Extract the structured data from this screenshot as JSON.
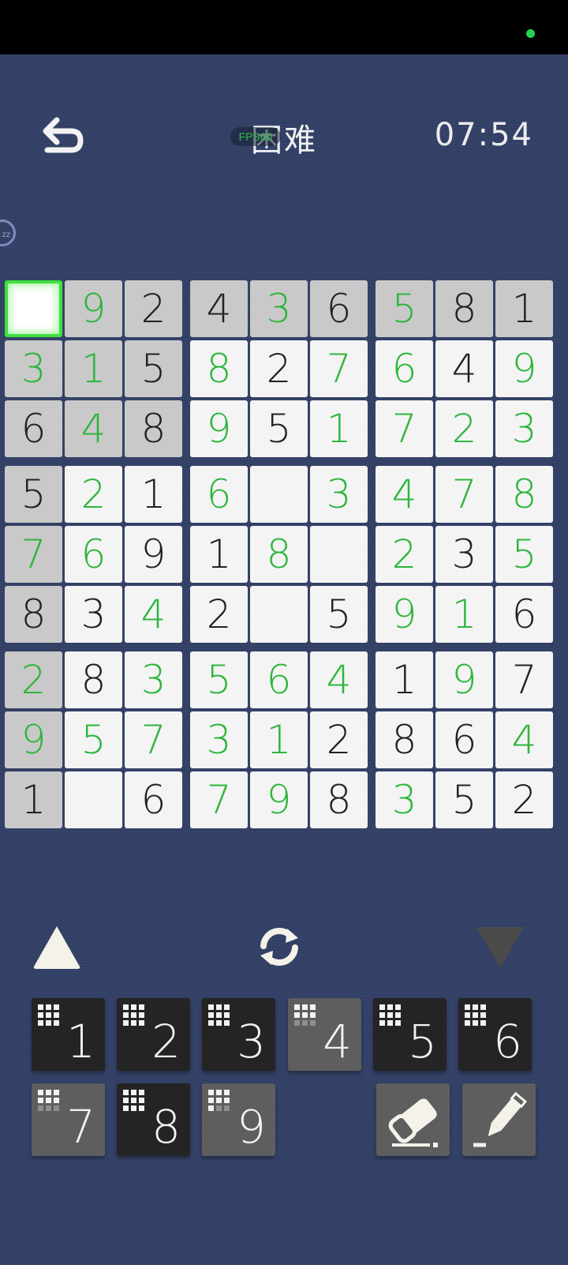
{
  "header": {
    "title": "困难",
    "fps_badge": "FPS60",
    "timer": "07:54",
    "side_badge": "zz"
  },
  "colors": {
    "background": "#334066",
    "given_cell": "#c9c9c9",
    "filled_cell": "#f4f4f4",
    "green_digit": "#2db63a",
    "dark_digit": "#222222",
    "selection": "#3fe03f"
  },
  "board": {
    "rows": [
      [
        "",
        "9",
        "2",
        "4",
        "3",
        "6",
        "5",
        "8",
        "1"
      ],
      [
        "3",
        "1",
        "5",
        "8",
        "2",
        "7",
        "6",
        "4",
        "9"
      ],
      [
        "6",
        "4",
        "8",
        "9",
        "5",
        "1",
        "7",
        "2",
        "3"
      ],
      [
        "5",
        "2",
        "1",
        "6",
        "",
        "3",
        "4",
        "7",
        "8"
      ],
      [
        "7",
        "6",
        "9",
        "1",
        "8",
        "",
        "2",
        "3",
        "5"
      ],
      [
        "8",
        "3",
        "4",
        "2",
        "",
        "5",
        "9",
        "1",
        "6"
      ],
      [
        "2",
        "8",
        "3",
        "5",
        "6",
        "4",
        "1",
        "9",
        "7"
      ],
      [
        "9",
        "5",
        "7",
        "3",
        "1",
        "2",
        "8",
        "6",
        "4"
      ],
      [
        "1",
        "",
        "6",
        "7",
        "9",
        "8",
        "3",
        "5",
        "2"
      ]
    ],
    "given": [
      [
        1,
        1,
        1,
        1,
        1,
        1,
        1,
        1,
        1
      ],
      [
        1,
        1,
        1,
        0,
        0,
        0,
        0,
        0,
        0
      ],
      [
        1,
        1,
        1,
        0,
        0,
        0,
        0,
        0,
        0
      ],
      [
        1,
        0,
        0,
        0,
        0,
        0,
        0,
        0,
        0
      ],
      [
        1,
        0,
        0,
        0,
        0,
        0,
        0,
        0,
        0
      ],
      [
        1,
        0,
        0,
        0,
        0,
        0,
        0,
        0,
        0
      ],
      [
        1,
        0,
        0,
        0,
        0,
        0,
        0,
        0,
        0
      ],
      [
        1,
        0,
        0,
        0,
        0,
        0,
        0,
        0,
        0
      ],
      [
        1,
        0,
        0,
        0,
        0,
        0,
        0,
        0,
        0
      ]
    ],
    "green": [
      [
        0,
        1,
        0,
        0,
        1,
        0,
        1,
        0,
        0
      ],
      [
        1,
        1,
        0,
        1,
        0,
        1,
        1,
        0,
        1
      ],
      [
        0,
        1,
        0,
        1,
        0,
        1,
        1,
        1,
        1
      ],
      [
        0,
        1,
        0,
        1,
        0,
        1,
        1,
        1,
        1
      ],
      [
        1,
        1,
        0,
        0,
        1,
        0,
        1,
        0,
        1
      ],
      [
        0,
        0,
        1,
        0,
        0,
        0,
        1,
        1,
        0
      ],
      [
        1,
        0,
        1,
        1,
        1,
        1,
        0,
        1,
        0
      ],
      [
        1,
        1,
        1,
        1,
        1,
        0,
        0,
        0,
        1
      ],
      [
        0,
        0,
        0,
        1,
        1,
        0,
        1,
        0,
        0
      ]
    ],
    "selected": [
      0,
      0
    ]
  },
  "keypad": {
    "keys": [
      {
        "label": "1",
        "used": false,
        "dots": 9
      },
      {
        "label": "2",
        "used": false,
        "dots": 9
      },
      {
        "label": "3",
        "used": false,
        "dots": 9
      },
      {
        "label": "4",
        "used": true,
        "dots": 6
      },
      {
        "label": "5",
        "used": false,
        "dots": 9
      },
      {
        "label": "6",
        "used": false,
        "dots": 9
      },
      {
        "label": "7",
        "used": true,
        "dots": 6
      },
      {
        "label": "8",
        "used": false,
        "dots": 9
      },
      {
        "label": "9",
        "used": true,
        "dots": 7
      }
    ],
    "tools": [
      {
        "name": "eraser-icon"
      },
      {
        "name": "pencil-icon"
      }
    ]
  }
}
